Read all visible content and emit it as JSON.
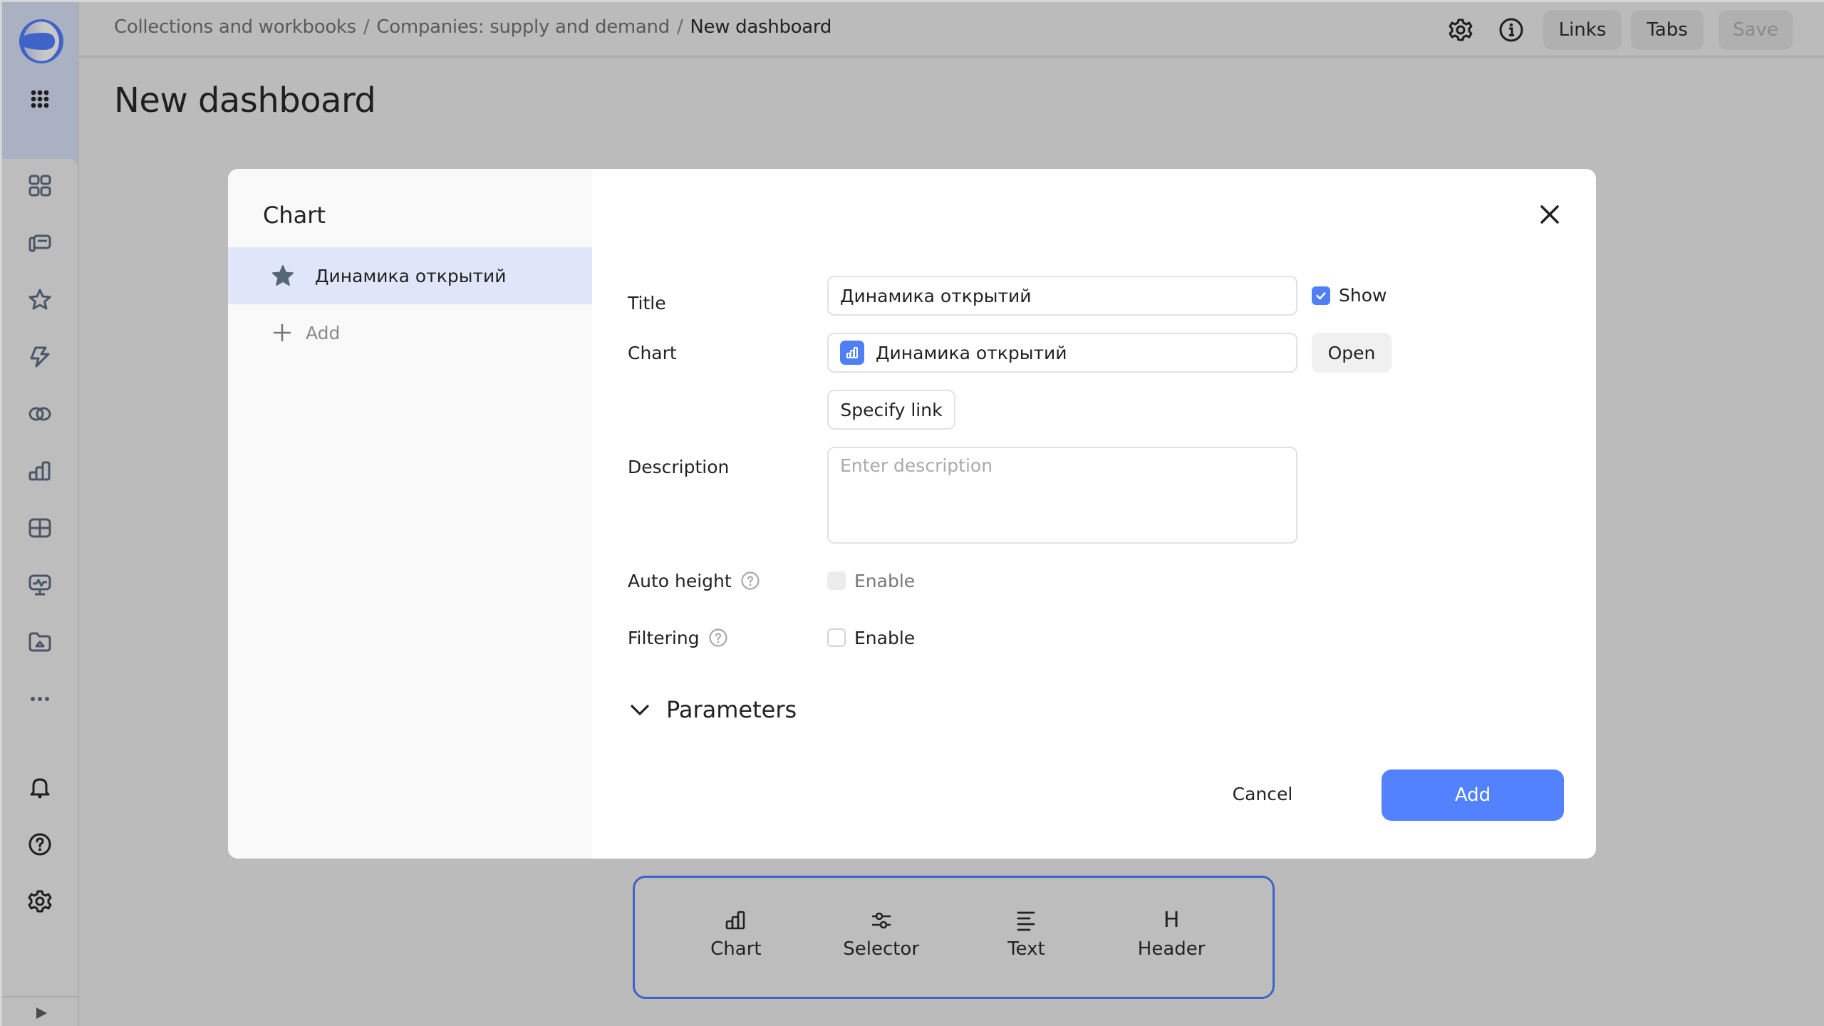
{
  "colors": {
    "accent": "#5282ff",
    "overlay": "#bbbbbb",
    "selected_item_bg": "#e0e6f9",
    "widget_bar_border": "#3e63c7"
  },
  "sidebar": {
    "logo": "datalens-logo",
    "items": [
      {
        "icon": "apps-grid-icon",
        "label": "All services"
      },
      {
        "icon": "dashboard-grid-icon",
        "label": "Dashboards"
      },
      {
        "icon": "collections-icon",
        "label": "Collections"
      },
      {
        "icon": "star-icon",
        "label": "Favorites"
      },
      {
        "icon": "lightning-icon",
        "label": "Connections"
      },
      {
        "icon": "datasets-icon",
        "label": "Datasets"
      },
      {
        "icon": "chart-icon",
        "label": "Charts"
      },
      {
        "icon": "table-icon",
        "label": "Tables"
      },
      {
        "icon": "monitor-icon",
        "label": "Monitoring"
      },
      {
        "icon": "folder-icon",
        "label": "Folder"
      },
      {
        "icon": "more-icon",
        "label": "More"
      }
    ],
    "bottom_items": [
      {
        "icon": "bell-icon",
        "label": "Notifications"
      },
      {
        "icon": "help-icon",
        "label": "Help"
      },
      {
        "icon": "settings-icon",
        "label": "Settings"
      }
    ],
    "collapse_icon": "play-icon"
  },
  "header": {
    "breadcrumbs": [
      "Collections and workbooks",
      "Companies: supply and demand"
    ],
    "current": "New dashboard",
    "separator": "/",
    "buttons": {
      "links": "Links",
      "tabs": "Tabs",
      "save": "Save"
    }
  },
  "page": {
    "title": "New dashboard"
  },
  "dialog": {
    "left_title": "Chart",
    "items": [
      {
        "label": "Динамика открытий",
        "selected": true
      }
    ],
    "add_label": "Add",
    "form": {
      "title_label": "Title",
      "title_value": "Динамика открытий",
      "show_label": "Show",
      "show_checked": true,
      "chart_label": "Chart",
      "chart_value": "Динамика открытий",
      "open_label": "Open",
      "specify_link_label": "Specify link",
      "description_label": "Description",
      "description_placeholder": "Enter description",
      "description_value": "",
      "auto_height_label": "Auto height",
      "auto_height_option": "Enable",
      "auto_height_checked": false,
      "auto_height_disabled": true,
      "filtering_label": "Filtering",
      "filtering_option": "Enable",
      "filtering_checked": false,
      "parameters_label": "Parameters"
    },
    "cancel_label": "Cancel",
    "submit_label": "Add"
  },
  "widget_bar": {
    "items": [
      {
        "label": "Chart",
        "icon": "chart-icon"
      },
      {
        "label": "Selector",
        "icon": "sliders-icon"
      },
      {
        "label": "Text",
        "icon": "text-icon"
      },
      {
        "label": "Header",
        "icon": "heading-icon",
        "glyph": "H"
      }
    ]
  }
}
